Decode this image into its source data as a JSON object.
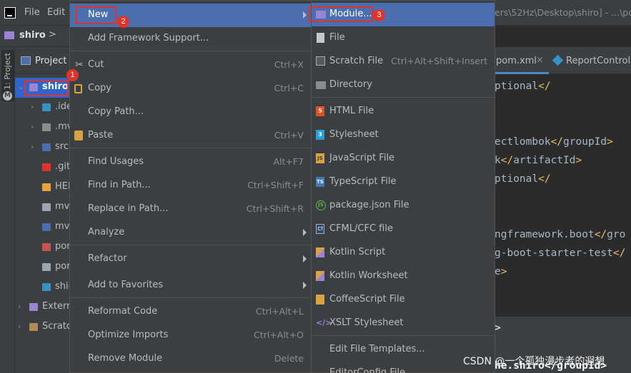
{
  "menubar": {
    "file": "File",
    "edit": "Edit",
    "title_path": "ers\\52Hz\\Desktop\\shiro] - ...\\pom"
  },
  "breadcrumb": {
    "root": "shiro",
    "chevron": ">"
  },
  "tool_window": {
    "strip_label": "1: Project",
    "strip_icon": "M",
    "header": "Project"
  },
  "tree": [
    {
      "label": "shiro",
      "icon": "module-folder-icon",
      "color": "#9b84d1",
      "arrow": "v",
      "selected": true
    },
    {
      "label": ".ide",
      "icon": "folder-icon",
      "color": "#3592c4",
      "arrow": ">"
    },
    {
      "label": ".mv",
      "icon": "folder-icon",
      "color": "#8c8c8c",
      "arrow": ">"
    },
    {
      "label": "src",
      "icon": "folder-icon",
      "color": "#4b6eaf",
      "arrow": ">"
    },
    {
      "label": ".giti",
      "icon": "git-icon",
      "color": "#e0332b"
    },
    {
      "label": "HEL",
      "icon": "markdown-icon",
      "color": "#e8a33a"
    },
    {
      "label": "mvr",
      "icon": "file-icon",
      "color": "#9aa7b0"
    },
    {
      "label": "mvr",
      "icon": "terminal-icon",
      "color": "#4b6eaf"
    },
    {
      "label": "por",
      "icon": "maven-icon",
      "color": "#c75450"
    },
    {
      "label": "por",
      "icon": "file-icon",
      "color": "#9aa7b0"
    },
    {
      "label": "shir",
      "icon": "java-icon",
      "color": "#3592c4"
    },
    {
      "label": "Extern",
      "icon": "library-icon",
      "color": "#9b84d1",
      "arrow": ">"
    },
    {
      "label": "Scratch",
      "icon": "scratch-icon",
      "color": "#b08b57",
      "arrow": ">"
    }
  ],
  "editor": {
    "tab_pom": "pom.xml",
    "tab_close": "×",
    "tab_report": "ReportControlle",
    "lines": [
      {
        "a": "ptional",
        "b": "</",
        "c": "",
        "d": ""
      },
      {
        "a": "ectlombok",
        "b": "</",
        "c": "groupId",
        "d": ">"
      },
      {
        "a": "k",
        "b": "</",
        "c": "artifactId",
        "d": ">"
      },
      {
        "a": "ptional",
        "b": "</",
        "c": "",
        "d": ""
      },
      {
        "a": "ngframework.boot",
        "b": "</",
        "c": "gro",
        "d": ""
      },
      {
        "a": "g-boot-starter-test",
        "b": "</",
        "c": "",
        "d": ""
      },
      {
        "a": "e",
        "b": ">",
        "c": "",
        "d": ""
      }
    ],
    "dark_line_1": ">",
    "dark_line_2": "he.shiro</groupId>"
  },
  "watermark": "CSDN @一个孤独漫步者的遐想",
  "main_menu": {
    "items": [
      {
        "label": "New",
        "shortcut": "",
        "submenu": true,
        "icon": ""
      },
      {
        "label": "Add Framework Support...",
        "shortcut": "",
        "icon": ""
      },
      {
        "label": "Cut",
        "shortcut": "Ctrl+X",
        "icon": "scissors-icon"
      },
      {
        "label": "Copy",
        "shortcut": "Ctrl+C",
        "icon": "copy-icon"
      },
      {
        "label": "Copy Path...",
        "shortcut": "",
        "icon": ""
      },
      {
        "label": "Paste",
        "shortcut": "Ctrl+V",
        "icon": "paste-icon"
      },
      {
        "label": "Find Usages",
        "shortcut": "Alt+F7",
        "icon": ""
      },
      {
        "label": "Find in Path...",
        "shortcut": "Ctrl+Shift+F",
        "icon": ""
      },
      {
        "label": "Replace in Path...",
        "shortcut": "Ctrl+Shift+R",
        "icon": ""
      },
      {
        "label": "Analyze",
        "shortcut": "",
        "submenu": true,
        "icon": ""
      },
      {
        "label": "Refactor",
        "shortcut": "",
        "submenu": true,
        "icon": ""
      },
      {
        "label": "Add to Favorites",
        "shortcut": "",
        "submenu": true,
        "icon": ""
      },
      {
        "label": "Reformat Code",
        "shortcut": "Ctrl+Alt+L",
        "icon": ""
      },
      {
        "label": "Optimize Imports",
        "shortcut": "Ctrl+Alt+O",
        "icon": ""
      },
      {
        "label": "Remove Module",
        "shortcut": "Delete",
        "icon": ""
      }
    ]
  },
  "new_submenu": {
    "items": [
      {
        "label": "Module...",
        "shortcut": "",
        "icon": "module-icon"
      },
      {
        "label": "File",
        "shortcut": "",
        "icon": "file-icon"
      },
      {
        "label": "Scratch File",
        "shortcut": "Ctrl+Alt+Shift+Insert",
        "icon": "scratch-file-icon"
      },
      {
        "label": "Directory",
        "shortcut": "",
        "icon": "directory-icon"
      },
      {
        "label": "HTML File",
        "shortcut": "",
        "icon": "html-icon",
        "glyph": "5"
      },
      {
        "label": "Stylesheet",
        "shortcut": "",
        "icon": "css-icon",
        "glyph": "3"
      },
      {
        "label": "JavaScript File",
        "shortcut": "",
        "icon": "javascript-icon",
        "glyph": "JS"
      },
      {
        "label": "TypeScript File",
        "shortcut": "",
        "icon": "typescript-icon",
        "glyph": "TS"
      },
      {
        "label": "package.json File",
        "shortcut": "",
        "icon": "nodejs-icon",
        "glyph": "JS"
      },
      {
        "label": "CFML/CFC file",
        "shortcut": "",
        "icon": "cfml-icon",
        "glyph": "Cf"
      },
      {
        "label": "Kotlin Script",
        "shortcut": "",
        "icon": "kotlin-icon"
      },
      {
        "label": "Kotlin Worksheet",
        "shortcut": "",
        "icon": "kotlin-icon"
      },
      {
        "label": "CoffeeScript File",
        "shortcut": "",
        "icon": "coffeescript-icon"
      },
      {
        "label": "XSLT Stylesheet",
        "shortcut": "",
        "icon": "xslt-icon",
        "glyph": "</>"
      },
      {
        "label": "Edit File Templates...",
        "shortcut": "",
        "icon": ""
      },
      {
        "label": "EditorConfig File",
        "shortcut": "",
        "icon": ""
      }
    ]
  },
  "annotations": [
    {
      "number": "1",
      "target": "shiro"
    },
    {
      "number": "2",
      "target": "New"
    },
    {
      "number": "3",
      "target": "Module..."
    }
  ],
  "colors": {
    "highlight": "#4b6eaf",
    "selection": "#2f65ca",
    "annotation_red": "#e0332b",
    "menu_bg": "#3c3f41",
    "xml_tag": "#e8bf6a"
  }
}
